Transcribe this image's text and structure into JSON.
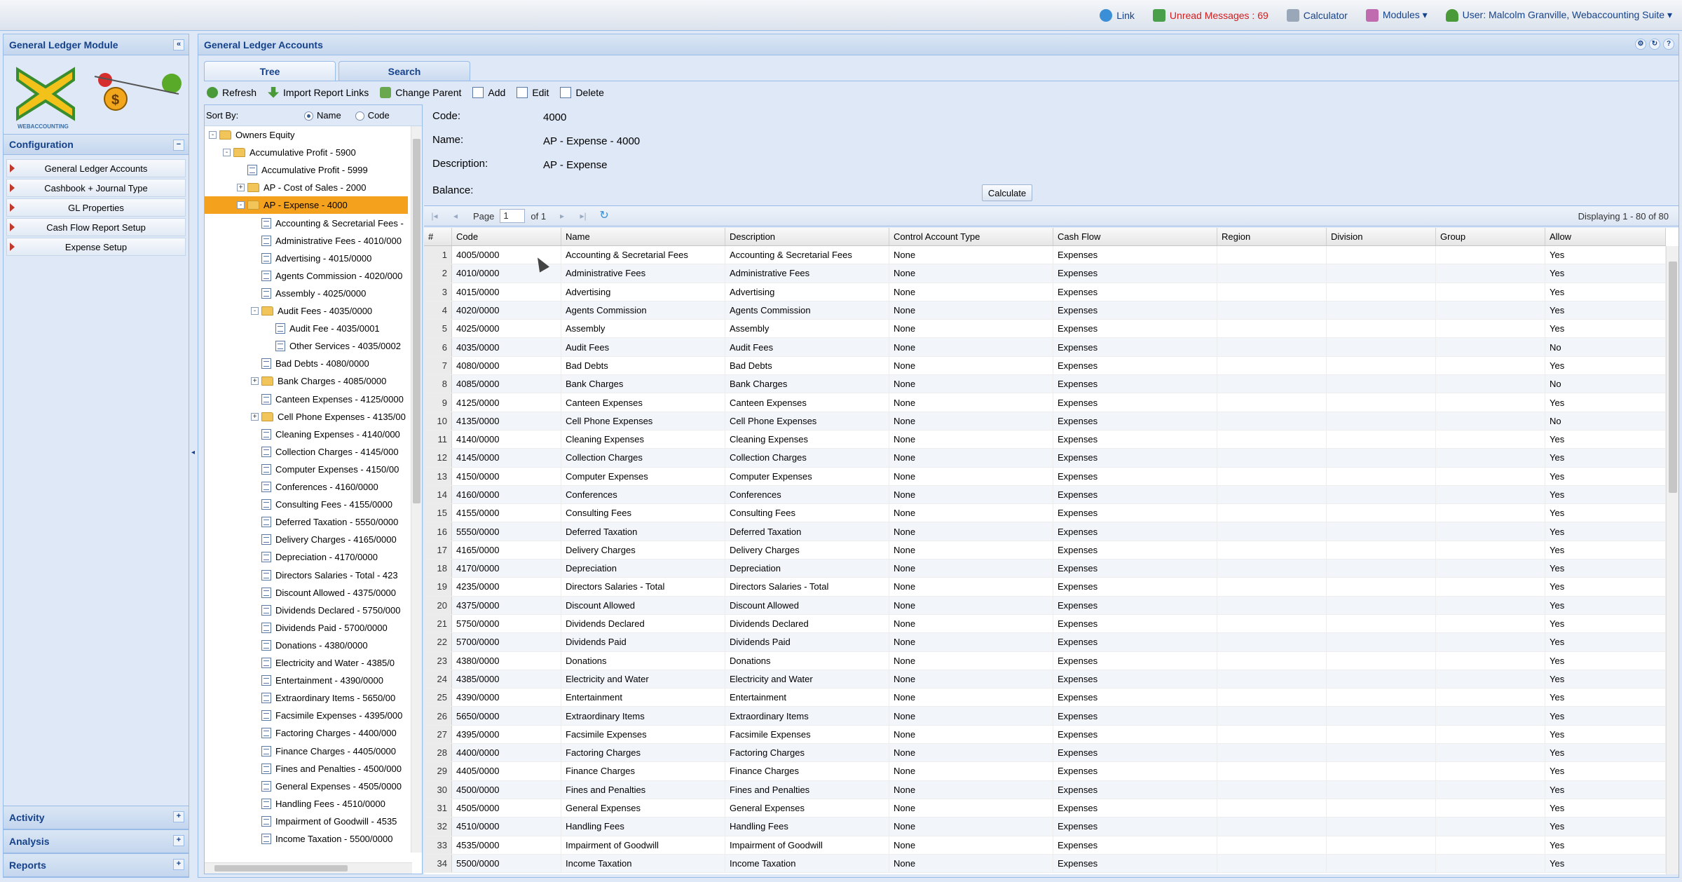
{
  "topbar": {
    "link": "Link",
    "unread": "Unread Messages : 69",
    "calculator": "Calculator",
    "modules": "Modules ▾",
    "user": "User: Malcolm Granville, Webaccounting Suite ▾"
  },
  "left": {
    "title": "General Ledger Module",
    "logo_text": "WEBACCOUNTING",
    "config_title": "Configuration",
    "menu": [
      "General Ledger Accounts",
      "Cashbook + Journal Type",
      "GL Properties",
      "Cash Flow Report Setup",
      "Expense Setup"
    ],
    "activity": "Activity",
    "analysis": "Analysis",
    "reports": "Reports"
  },
  "main": {
    "title": "General Ledger Accounts",
    "tabs": [
      "Tree",
      "Search"
    ],
    "toolbar": [
      "Refresh",
      "Import Report Links",
      "Change Parent",
      "Add",
      "Edit",
      "Delete"
    ],
    "sort_label": "Sort By:",
    "sort_name": "Name",
    "sort_code": "Code"
  },
  "tree": [
    {
      "label": "Owners Equity",
      "level": 0,
      "type": "folder",
      "toggle": "-"
    },
    {
      "label": "Accumulative Profit - 5900",
      "level": 1,
      "type": "folder",
      "toggle": "-"
    },
    {
      "label": "Accumulative Profit - 5999",
      "level": 2,
      "type": "leaf"
    },
    {
      "label": "AP - Cost of Sales - 2000",
      "level": 2,
      "type": "folder",
      "toggle": "+"
    },
    {
      "label": "AP - Expense - 4000",
      "level": 2,
      "type": "folder",
      "toggle": "-",
      "selected": true
    },
    {
      "label": "Accounting & Secretarial Fees -",
      "level": 3,
      "type": "leaf"
    },
    {
      "label": "Administrative Fees - 4010/000",
      "level": 3,
      "type": "leaf"
    },
    {
      "label": "Advertising - 4015/0000",
      "level": 3,
      "type": "leaf"
    },
    {
      "label": "Agents Commission - 4020/000",
      "level": 3,
      "type": "leaf"
    },
    {
      "label": "Assembly - 4025/0000",
      "level": 3,
      "type": "leaf"
    },
    {
      "label": "Audit Fees - 4035/0000",
      "level": 3,
      "type": "folder",
      "toggle": "-"
    },
    {
      "label": "Audit Fee - 4035/0001",
      "level": 4,
      "type": "leaf"
    },
    {
      "label": "Other Services - 4035/0002",
      "level": 4,
      "type": "leaf"
    },
    {
      "label": "Bad Debts - 4080/0000",
      "level": 3,
      "type": "leaf"
    },
    {
      "label": "Bank Charges - 4085/0000",
      "level": 3,
      "type": "folder",
      "toggle": "+"
    },
    {
      "label": "Canteen Expenses - 4125/0000",
      "level": 3,
      "type": "leaf"
    },
    {
      "label": "Cell Phone Expenses - 4135/00",
      "level": 3,
      "type": "folder",
      "toggle": "+"
    },
    {
      "label": "Cleaning Expenses - 4140/000",
      "level": 3,
      "type": "leaf"
    },
    {
      "label": "Collection Charges - 4145/000",
      "level": 3,
      "type": "leaf"
    },
    {
      "label": "Computer Expenses - 4150/00",
      "level": 3,
      "type": "leaf"
    },
    {
      "label": "Conferences - 4160/0000",
      "level": 3,
      "type": "leaf"
    },
    {
      "label": "Consulting Fees - 4155/0000",
      "level": 3,
      "type": "leaf"
    },
    {
      "label": "Deferred Taxation - 5550/0000",
      "level": 3,
      "type": "leaf"
    },
    {
      "label": "Delivery Charges - 4165/0000",
      "level": 3,
      "type": "leaf"
    },
    {
      "label": "Depreciation - 4170/0000",
      "level": 3,
      "type": "leaf"
    },
    {
      "label": "Directors Salaries - Total - 423",
      "level": 3,
      "type": "leaf"
    },
    {
      "label": "Discount Allowed - 4375/0000",
      "level": 3,
      "type": "leaf"
    },
    {
      "label": "Dividends Declared - 5750/000",
      "level": 3,
      "type": "leaf"
    },
    {
      "label": "Dividends Paid - 5700/0000",
      "level": 3,
      "type": "leaf"
    },
    {
      "label": "Donations - 4380/0000",
      "level": 3,
      "type": "leaf"
    },
    {
      "label": "Electricity and Water - 4385/0",
      "level": 3,
      "type": "leaf"
    },
    {
      "label": "Entertainment - 4390/0000",
      "level": 3,
      "type": "leaf"
    },
    {
      "label": "Extraordinary Items - 5650/00",
      "level": 3,
      "type": "leaf"
    },
    {
      "label": "Facsimile Expenses - 4395/000",
      "level": 3,
      "type": "leaf"
    },
    {
      "label": "Factoring Charges - 4400/000",
      "level": 3,
      "type": "leaf"
    },
    {
      "label": "Finance Charges - 4405/0000",
      "level": 3,
      "type": "leaf"
    },
    {
      "label": "Fines and Penalties - 4500/000",
      "level": 3,
      "type": "leaf"
    },
    {
      "label": "General Expenses - 4505/0000",
      "level": 3,
      "type": "leaf"
    },
    {
      "label": "Handling Fees - 4510/0000",
      "level": 3,
      "type": "leaf"
    },
    {
      "label": "Impairment of Goodwill - 4535",
      "level": 3,
      "type": "leaf"
    },
    {
      "label": "Income Taxation - 5500/0000",
      "level": 3,
      "type": "leaf"
    }
  ],
  "detail": {
    "code_label": "Code:",
    "code": "4000",
    "name_label": "Name:",
    "name": "AP - Expense - 4000",
    "desc_label": "Description:",
    "desc": "AP - Expense",
    "balance_label": "Balance:",
    "calculate": "Calculate"
  },
  "pager": {
    "page_label": "Page",
    "page": "1",
    "of": "of 1",
    "displaying": "Displaying 1 - 80 of 80"
  },
  "grid": {
    "columns": [
      "#",
      "Code",
      "Name",
      "Description",
      "Control Account Type",
      "Cash Flow",
      "Region",
      "Division",
      "Group",
      "Allow"
    ],
    "rows": [
      [
        "1",
        "4005/0000",
        "Accounting & Secretarial Fees",
        "Accounting & Secretarial Fees",
        "None",
        "Expenses",
        "",
        "",
        "",
        "Yes"
      ],
      [
        "2",
        "4010/0000",
        "Administrative Fees",
        "Administrative Fees",
        "None",
        "Expenses",
        "",
        "",
        "",
        "Yes"
      ],
      [
        "3",
        "4015/0000",
        "Advertising",
        "Advertising",
        "None",
        "Expenses",
        "",
        "",
        "",
        "Yes"
      ],
      [
        "4",
        "4020/0000",
        "Agents Commission",
        "Agents Commission",
        "None",
        "Expenses",
        "",
        "",
        "",
        "Yes"
      ],
      [
        "5",
        "4025/0000",
        "Assembly",
        "Assembly",
        "None",
        "Expenses",
        "",
        "",
        "",
        "Yes"
      ],
      [
        "6",
        "4035/0000",
        "Audit Fees",
        "Audit Fees",
        "None",
        "Expenses",
        "",
        "",
        "",
        "No"
      ],
      [
        "7",
        "4080/0000",
        "Bad Debts",
        "Bad Debts",
        "None",
        "Expenses",
        "",
        "",
        "",
        "Yes"
      ],
      [
        "8",
        "4085/0000",
        "Bank Charges",
        "Bank Charges",
        "None",
        "Expenses",
        "",
        "",
        "",
        "No"
      ],
      [
        "9",
        "4125/0000",
        "Canteen Expenses",
        "Canteen Expenses",
        "None",
        "Expenses",
        "",
        "",
        "",
        "Yes"
      ],
      [
        "10",
        "4135/0000",
        "Cell Phone Expenses",
        "Cell Phone Expenses",
        "None",
        "Expenses",
        "",
        "",
        "",
        "No"
      ],
      [
        "11",
        "4140/0000",
        "Cleaning Expenses",
        "Cleaning Expenses",
        "None",
        "Expenses",
        "",
        "",
        "",
        "Yes"
      ],
      [
        "12",
        "4145/0000",
        "Collection Charges",
        "Collection Charges",
        "None",
        "Expenses",
        "",
        "",
        "",
        "Yes"
      ],
      [
        "13",
        "4150/0000",
        "Computer Expenses",
        "Computer Expenses",
        "None",
        "Expenses",
        "",
        "",
        "",
        "Yes"
      ],
      [
        "14",
        "4160/0000",
        "Conferences",
        "Conferences",
        "None",
        "Expenses",
        "",
        "",
        "",
        "Yes"
      ],
      [
        "15",
        "4155/0000",
        "Consulting Fees",
        "Consulting Fees",
        "None",
        "Expenses",
        "",
        "",
        "",
        "Yes"
      ],
      [
        "16",
        "5550/0000",
        "Deferred Taxation",
        "Deferred Taxation",
        "None",
        "Expenses",
        "",
        "",
        "",
        "Yes"
      ],
      [
        "17",
        "4165/0000",
        "Delivery Charges",
        "Delivery Charges",
        "None",
        "Expenses",
        "",
        "",
        "",
        "Yes"
      ],
      [
        "18",
        "4170/0000",
        "Depreciation",
        "Depreciation",
        "None",
        "Expenses",
        "",
        "",
        "",
        "Yes"
      ],
      [
        "19",
        "4235/0000",
        "Directors Salaries - Total",
        "Directors Salaries - Total",
        "None",
        "Expenses",
        "",
        "",
        "",
        "Yes"
      ],
      [
        "20",
        "4375/0000",
        "Discount Allowed",
        "Discount Allowed",
        "None",
        "Expenses",
        "",
        "",
        "",
        "Yes"
      ],
      [
        "21",
        "5750/0000",
        "Dividends Declared",
        "Dividends Declared",
        "None",
        "Expenses",
        "",
        "",
        "",
        "Yes"
      ],
      [
        "22",
        "5700/0000",
        "Dividends Paid",
        "Dividends Paid",
        "None",
        "Expenses",
        "",
        "",
        "",
        "Yes"
      ],
      [
        "23",
        "4380/0000",
        "Donations",
        "Donations",
        "None",
        "Expenses",
        "",
        "",
        "",
        "Yes"
      ],
      [
        "24",
        "4385/0000",
        "Electricity and Water",
        "Electricity and Water",
        "None",
        "Expenses",
        "",
        "",
        "",
        "Yes"
      ],
      [
        "25",
        "4390/0000",
        "Entertainment",
        "Entertainment",
        "None",
        "Expenses",
        "",
        "",
        "",
        "Yes"
      ],
      [
        "26",
        "5650/0000",
        "Extraordinary Items",
        "Extraordinary Items",
        "None",
        "Expenses",
        "",
        "",
        "",
        "Yes"
      ],
      [
        "27",
        "4395/0000",
        "Facsimile Expenses",
        "Facsimile Expenses",
        "None",
        "Expenses",
        "",
        "",
        "",
        "Yes"
      ],
      [
        "28",
        "4400/0000",
        "Factoring Charges",
        "Factoring Charges",
        "None",
        "Expenses",
        "",
        "",
        "",
        "Yes"
      ],
      [
        "29",
        "4405/0000",
        "Finance Charges",
        "Finance Charges",
        "None",
        "Expenses",
        "",
        "",
        "",
        "Yes"
      ],
      [
        "30",
        "4500/0000",
        "Fines and Penalties",
        "Fines and Penalties",
        "None",
        "Expenses",
        "",
        "",
        "",
        "Yes"
      ],
      [
        "31",
        "4505/0000",
        "General Expenses",
        "General Expenses",
        "None",
        "Expenses",
        "",
        "",
        "",
        "Yes"
      ],
      [
        "32",
        "4510/0000",
        "Handling Fees",
        "Handling Fees",
        "None",
        "Expenses",
        "",
        "",
        "",
        "Yes"
      ],
      [
        "33",
        "4535/0000",
        "Impairment of Goodwill",
        "Impairment of Goodwill",
        "None",
        "Expenses",
        "",
        "",
        "",
        "Yes"
      ],
      [
        "34",
        "5500/0000",
        "Income Taxation",
        "Income Taxation",
        "None",
        "Expenses",
        "",
        "",
        "",
        "Yes"
      ]
    ]
  },
  "colors": {
    "accent": "#15428b",
    "selected": "#f4a21e",
    "unread": "#d21d1d",
    "panel": "#dfe8f6"
  }
}
